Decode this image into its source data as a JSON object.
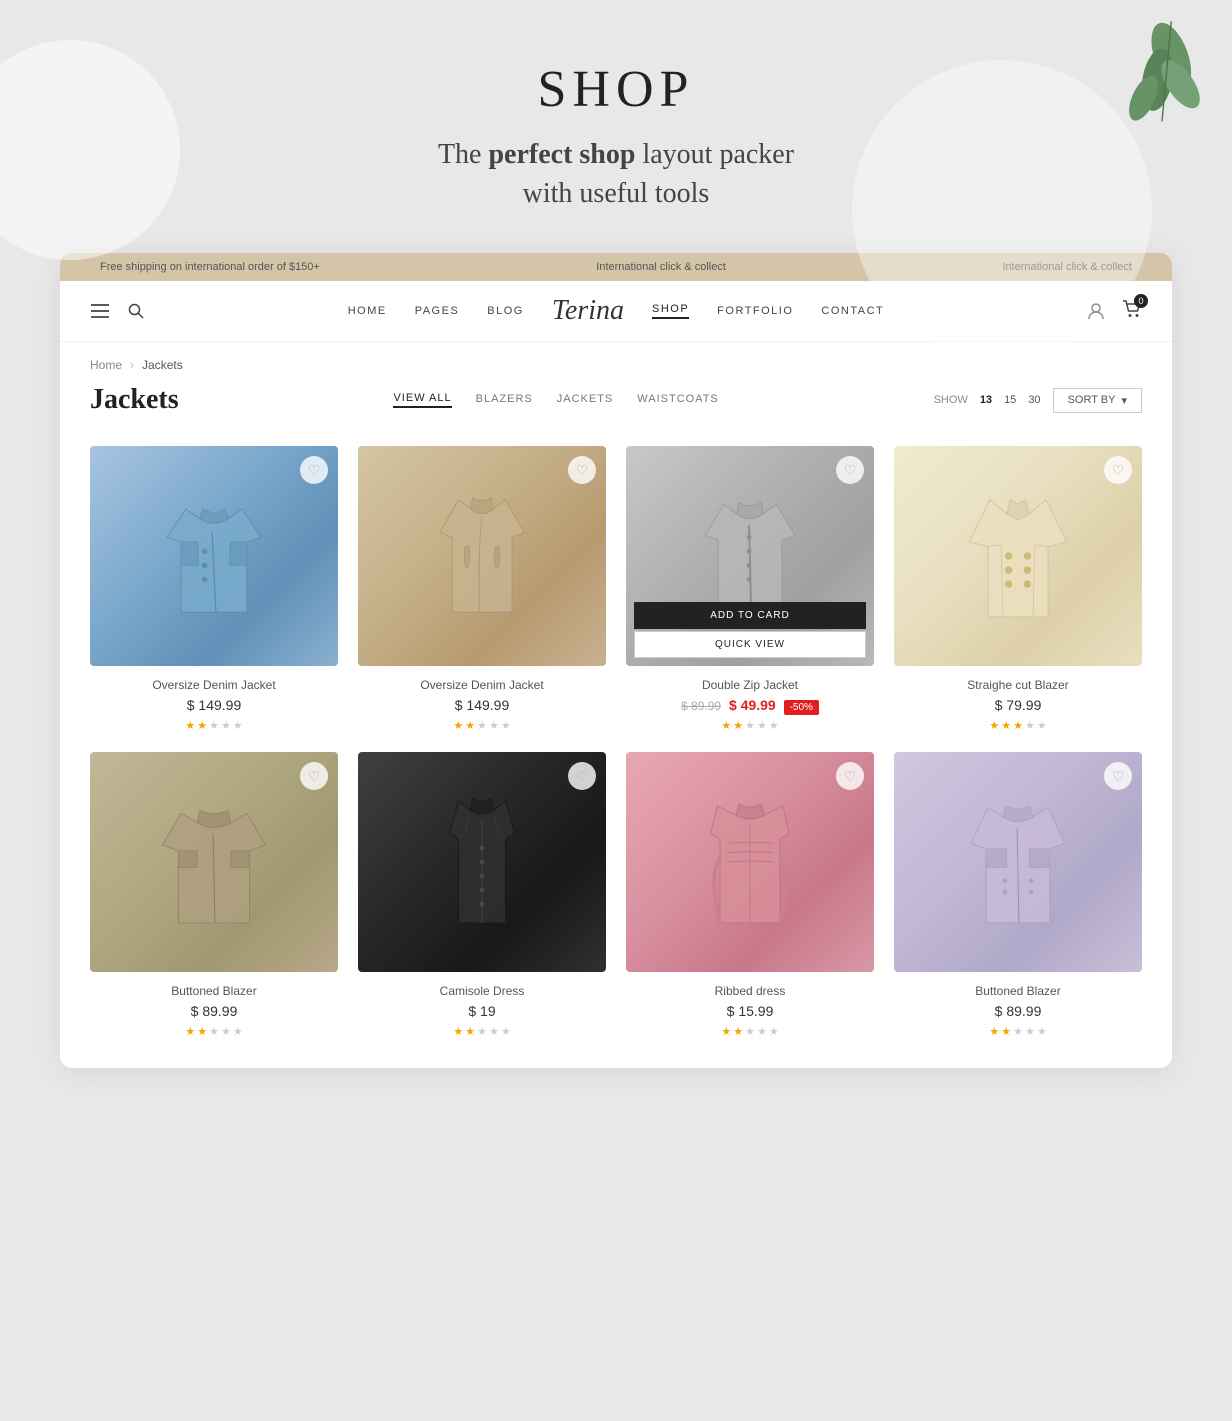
{
  "hero": {
    "title": "SHOP",
    "subtitle_start": "The ",
    "subtitle_bold": "perfect shop",
    "subtitle_end": " layout packer",
    "subtitle_line2": "with useful tools"
  },
  "banner": {
    "left": "Free shipping on international order of $150+",
    "center": "International click & collect",
    "right": "International click & collect"
  },
  "navbar": {
    "links": [
      "HOME",
      "PAGES",
      "BLOG",
      "SHOP",
      "FORTFOLIO",
      "CONTACT"
    ],
    "active": "SHOP",
    "brand": "Terina",
    "cart_count": "0"
  },
  "breadcrumb": {
    "home": "Home",
    "current": "Jackets"
  },
  "shop": {
    "title": "Jackets",
    "filter_tabs": [
      "VIEW ALL",
      "BLAZERS",
      "JACKETS",
      "WAISTCOATS"
    ],
    "active_filter": "VIEW ALL",
    "show_label": "SHOW",
    "show_options": [
      "13",
      "15",
      "30"
    ],
    "active_show": "13",
    "sort_label": "SORT BY"
  },
  "products": [
    {
      "id": 1,
      "name": "Oversize Denim Jacket",
      "price": "$ 149.99",
      "price_sale": null,
      "price_original": null,
      "discount": null,
      "stars": 2,
      "type": "denim-jacket"
    },
    {
      "id": 2,
      "name": "Oversize Denim Jacket",
      "price": "$ 149.99",
      "price_sale": null,
      "price_original": null,
      "discount": null,
      "stars": 2,
      "type": "beige-jacket"
    },
    {
      "id": 3,
      "name": "Double Zip Jacket",
      "price": null,
      "price_sale": "$ 49.99",
      "price_original": "$ 89.99",
      "discount": "-50%",
      "stars": 2,
      "type": "gray-jacket",
      "show_overlay": true
    },
    {
      "id": 4,
      "name": "Straighe cut Blazer",
      "price": "$ 79.99",
      "price_sale": null,
      "price_original": null,
      "discount": null,
      "stars": 3,
      "type": "cream-blazer"
    },
    {
      "id": 5,
      "name": "Buttoned Blazer",
      "price": "$ 89.99",
      "price_sale": null,
      "price_original": null,
      "discount": null,
      "stars": 2,
      "type": "olive-jacket"
    },
    {
      "id": 6,
      "name": "Camisole Dress",
      "price": "$ 19",
      "price_sale": null,
      "price_original": null,
      "discount": null,
      "stars": 2,
      "type": "black-vest"
    },
    {
      "id": 7,
      "name": "Ribbed dress",
      "price": "$ 15.99",
      "price_sale": null,
      "price_original": null,
      "discount": null,
      "stars": 2,
      "type": "pink-dress"
    },
    {
      "id": 8,
      "name": "Buttoned Blazer",
      "price": "$ 89.99",
      "price_sale": null,
      "price_original": null,
      "discount": null,
      "stars": 2,
      "type": "lavender-jacket"
    }
  ],
  "overlay_buttons": {
    "add_to_cart": "ADD TO CARD",
    "quick_view": "QUICK VIEW"
  }
}
